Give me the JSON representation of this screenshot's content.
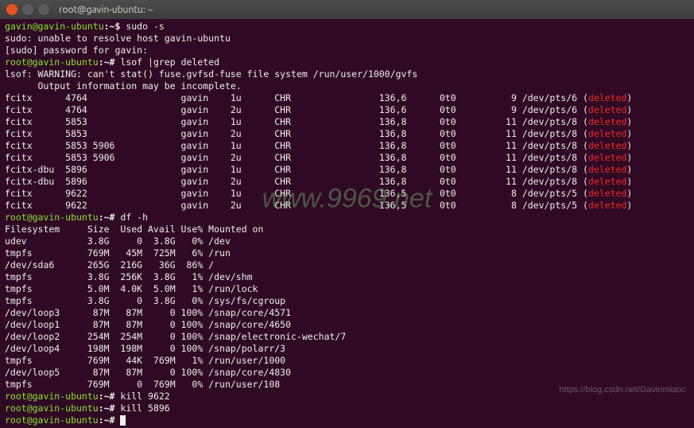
{
  "titlebar": {
    "title": "root@gavin-ubuntu: ~"
  },
  "prompts": {
    "user": "gavin@gavin-ubuntu",
    "root": "root@gavin-ubuntu",
    "sep": ":",
    "path": "~",
    "user_sym": "$",
    "root_sym": "#"
  },
  "commands": {
    "cmd1": "sudo -s",
    "cmd2": "lsof |grep deleted",
    "cmd3": "df -h",
    "cmd4": "kill 9622",
    "cmd5": "kill 5896"
  },
  "sudo_msgs": {
    "l1": "sudo: unable to resolve host gavin-ubuntu",
    "l2": "[sudo] password for gavin:"
  },
  "lsof_msgs": {
    "l1": "lsof: WARNING: can't stat() fuse.gvfsd-fuse file system /run/user/1000/gvfs",
    "l2": "      Output information may be incomplete."
  },
  "lsof_rows": [
    {
      "proc": "fcitx",
      "pid": "4764",
      "tid": "",
      "user": "gavin",
      "fd": "1u",
      "type": "CHR",
      "dev": "136,6",
      "off": "0t0",
      "node": "9",
      "name": "/dev/pts/6"
    },
    {
      "proc": "fcitx",
      "pid": "4764",
      "tid": "",
      "user": "gavin",
      "fd": "2u",
      "type": "CHR",
      "dev": "136,6",
      "off": "0t0",
      "node": "9",
      "name": "/dev/pts/6"
    },
    {
      "proc": "fcitx",
      "pid": "5853",
      "tid": "",
      "user": "gavin",
      "fd": "1u",
      "type": "CHR",
      "dev": "136,8",
      "off": "0t0",
      "node": "11",
      "name": "/dev/pts/8"
    },
    {
      "proc": "fcitx",
      "pid": "5853",
      "tid": "",
      "user": "gavin",
      "fd": "2u",
      "type": "CHR",
      "dev": "136,8",
      "off": "0t0",
      "node": "11",
      "name": "/dev/pts/8"
    },
    {
      "proc": "fcitx",
      "pid": "5853",
      "tid": "5906",
      "user": "gavin",
      "fd": "1u",
      "type": "CHR",
      "dev": "136,8",
      "off": "0t0",
      "node": "11",
      "name": "/dev/pts/8"
    },
    {
      "proc": "fcitx",
      "pid": "5853",
      "tid": "5906",
      "user": "gavin",
      "fd": "2u",
      "type": "CHR",
      "dev": "136,8",
      "off": "0t0",
      "node": "11",
      "name": "/dev/pts/8"
    },
    {
      "proc": "fcitx-dbu",
      "pid": "5896",
      "tid": "",
      "user": "gavin",
      "fd": "1u",
      "type": "CHR",
      "dev": "136,8",
      "off": "0t0",
      "node": "11",
      "name": "/dev/pts/8"
    },
    {
      "proc": "fcitx-dbu",
      "pid": "5896",
      "tid": "",
      "user": "gavin",
      "fd": "2u",
      "type": "CHR",
      "dev": "136,8",
      "off": "0t0",
      "node": "11",
      "name": "/dev/pts/8"
    },
    {
      "proc": "fcitx",
      "pid": "9622",
      "tid": "",
      "user": "gavin",
      "fd": "1u",
      "type": "CHR",
      "dev": "136,5",
      "off": "0t0",
      "node": "8",
      "name": "/dev/pts/5"
    },
    {
      "proc": "fcitx",
      "pid": "9622",
      "tid": "",
      "user": "gavin",
      "fd": "2u",
      "type": "CHR",
      "dev": "136,5",
      "off": "0t0",
      "node": "8",
      "name": "/dev/pts/5"
    }
  ],
  "deleted_label": "deleted",
  "df_header": {
    "fs": "Filesystem",
    "size": "Size",
    "used": "Used",
    "avail": "Avail",
    "usep": "Use%",
    "mount": "Mounted on"
  },
  "df_rows": [
    {
      "fs": "udev",
      "size": "3.8G",
      "used": "0",
      "avail": "3.8G",
      "usep": "0%",
      "mount": "/dev"
    },
    {
      "fs": "tmpfs",
      "size": "769M",
      "used": "45M",
      "avail": "725M",
      "usep": "6%",
      "mount": "/run"
    },
    {
      "fs": "/dev/sda6",
      "size": "265G",
      "used": "216G",
      "avail": "36G",
      "usep": "86%",
      "mount": "/"
    },
    {
      "fs": "tmpfs",
      "size": "3.8G",
      "used": "256K",
      "avail": "3.8G",
      "usep": "1%",
      "mount": "/dev/shm"
    },
    {
      "fs": "tmpfs",
      "size": "5.0M",
      "used": "4.0K",
      "avail": "5.0M",
      "usep": "1%",
      "mount": "/run/lock"
    },
    {
      "fs": "tmpfs",
      "size": "3.8G",
      "used": "0",
      "avail": "3.8G",
      "usep": "0%",
      "mount": "/sys/fs/cgroup"
    },
    {
      "fs": "/dev/loop3",
      "size": "87M",
      "used": "87M",
      "avail": "0",
      "usep": "100%",
      "mount": "/snap/core/4571"
    },
    {
      "fs": "/dev/loop1",
      "size": "87M",
      "used": "87M",
      "avail": "0",
      "usep": "100%",
      "mount": "/snap/core/4650"
    },
    {
      "fs": "/dev/loop2",
      "size": "254M",
      "used": "254M",
      "avail": "0",
      "usep": "100%",
      "mount": "/snap/electronic-wechat/7"
    },
    {
      "fs": "/dev/loop4",
      "size": "198M",
      "used": "198M",
      "avail": "0",
      "usep": "100%",
      "mount": "/snap/polarr/3"
    },
    {
      "fs": "tmpfs",
      "size": "769M",
      "used": "44K",
      "avail": "769M",
      "usep": "1%",
      "mount": "/run/user/1000"
    },
    {
      "fs": "/dev/loop5",
      "size": "87M",
      "used": "87M",
      "avail": "0",
      "usep": "100%",
      "mount": "/snap/core/4830"
    },
    {
      "fs": "tmpfs",
      "size": "769M",
      "used": "0",
      "avail": "769M",
      "usep": "0%",
      "mount": "/run/user/108"
    }
  ],
  "watermark": "www.9969.net",
  "footer": "https://blog.csdn.net/Gavinmiaoc"
}
